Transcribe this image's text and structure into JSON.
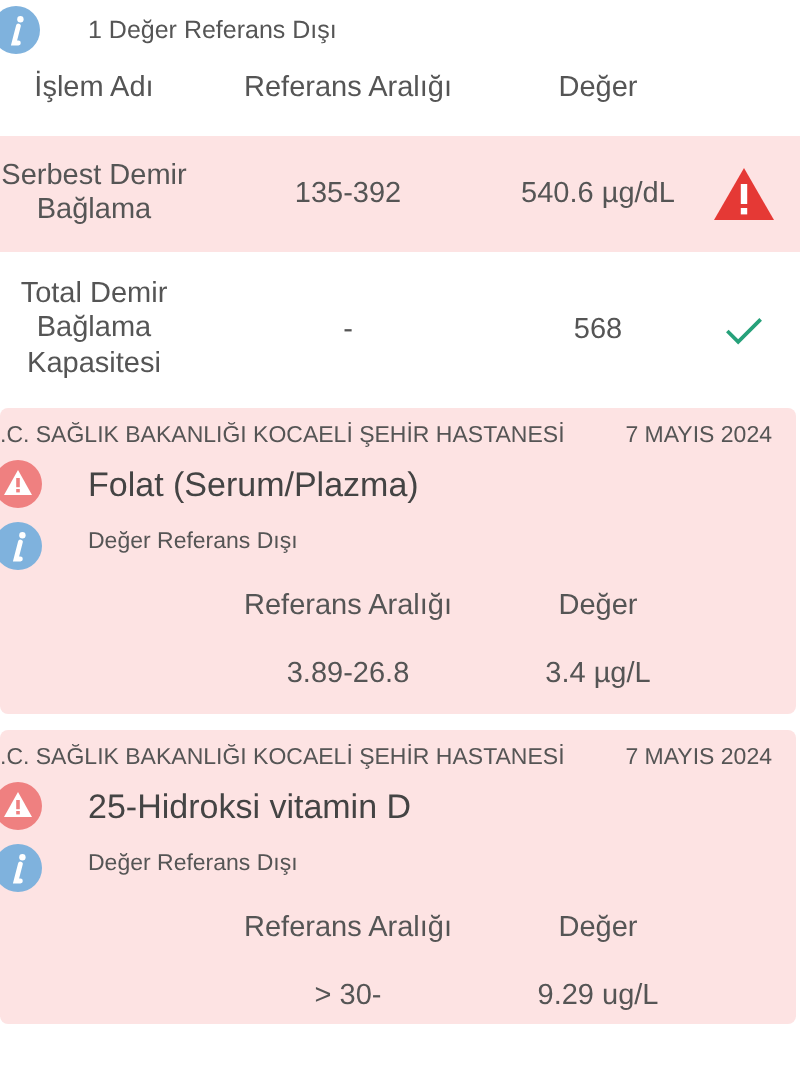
{
  "summary": {
    "text": "1 Değer Referans Dışı"
  },
  "table": {
    "columns": [
      "İşlem Adı",
      "Referans Aralığı",
      "Değer"
    ],
    "rows": [
      {
        "name": "Serbest Demir Bağlama",
        "range": "135-392",
        "value": "540.6 µg/dL",
        "out_of_range": true
      },
      {
        "name": "Total Demir Bağlama Kapasitesi",
        "range": "-",
        "value": "568",
        "out_of_range": false
      }
    ]
  },
  "cards": [
    {
      "hospital": ".C. SAĞLIK BAKANLIĞI KOCAELİ ŞEHİR HASTANESİ",
      "date": "7 MAYIS 2024",
      "test": "Folat (Serum/Plazma)",
      "note": "Değer Referans Dışı",
      "columns": [
        "Referans Aralığı",
        "Değer"
      ],
      "range": "3.89-26.8",
      "value": "3.4 µg/L"
    },
    {
      "hospital": ".C. SAĞLIK BAKANLIĞI KOCAELİ ŞEHİR HASTANESİ",
      "date": "7 MAYIS 2024",
      "test": "25-Hidroksi vitamin D",
      "note": "Değer Referans Dışı",
      "columns": [
        "Referans Aralığı",
        "Değer"
      ],
      "range": "> 30-",
      "value": "9.29 ug/L"
    }
  ]
}
